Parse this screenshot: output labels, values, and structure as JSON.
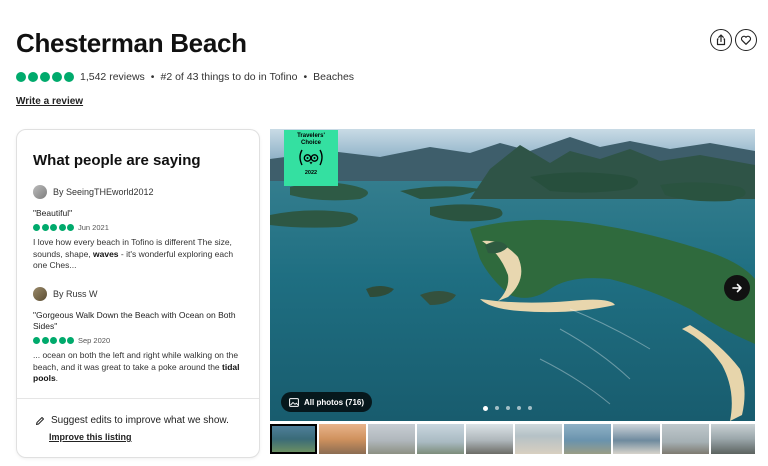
{
  "header": {
    "title": "Chesterman Beach",
    "share_icon": "share-icon",
    "save_icon": "heart-icon"
  },
  "meta": {
    "rating_bubbles": 5,
    "reviews": "1,542 reviews",
    "rank": "#2 of 43 things to do in Tofino",
    "category": "Beaches",
    "bubble_color": "#00aa6c"
  },
  "write_review": "Write a review",
  "sidebar": {
    "title": "What people are saying",
    "reviews": [
      {
        "author": "By SeeingTHEworld2012",
        "quote": "\"Beautiful\"",
        "rating_bubbles": 5,
        "date": "Jun 2021",
        "excerpt_prefix": "I love how every beach in Tofino is different The size, sounds, shape, ",
        "excerpt_bold": "waves",
        "excerpt_suffix": " - it's wonderful exploring each one Ches..."
      },
      {
        "author": "By Russ W",
        "quote": "\"Gorgeous Walk Down the Beach with Ocean on Both Sides\"",
        "rating_bubbles": 5,
        "date": "Sep 2020",
        "excerpt_prefix": "... ocean on both the left and right while walking on the beach, and it was great to take a poke around the ",
        "excerpt_bold": "tidal pools",
        "excerpt_suffix": "."
      }
    ],
    "suggest": "Suggest edits to improve what we show.",
    "improve": "Improve this listing"
  },
  "hero": {
    "badge_line1": "Travelers'",
    "badge_line2": "Choice",
    "badge_year": "2022",
    "badge_color": "#34e0a1",
    "all_photos": "All photos (716)",
    "pager_count": 5,
    "pager_active": 0
  },
  "thumbnails_count": 10
}
